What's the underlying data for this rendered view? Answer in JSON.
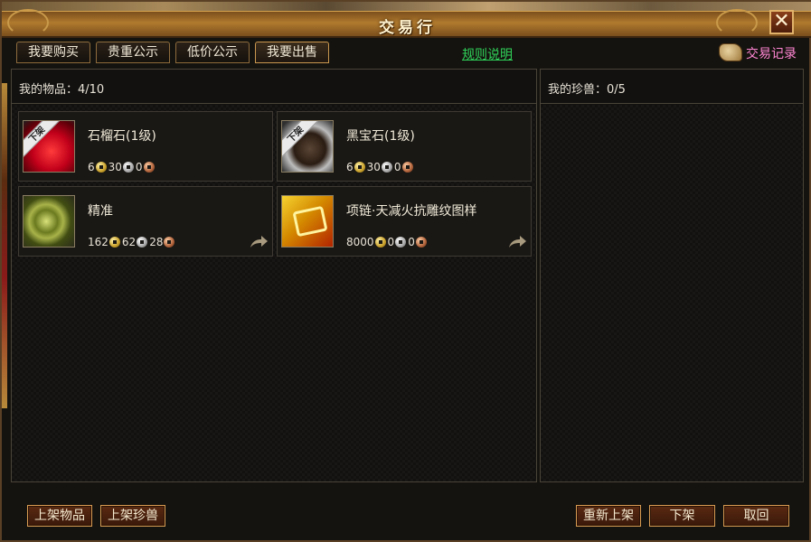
{
  "window": {
    "title": "交易行",
    "close_symbol": "✕"
  },
  "tabs": [
    {
      "label": "我要购买"
    },
    {
      "label": "贵重公示"
    },
    {
      "label": "低价公示"
    },
    {
      "label": "我要出售"
    }
  ],
  "rules_link": "规则说明",
  "trade_record": "交易记录",
  "items_panel": {
    "header": "我的物品：4/10",
    "items": [
      {
        "name": "石榴石(1级)",
        "ribbon": "下架",
        "icon": "garnet-gem-icon",
        "gold": "6",
        "silver": "30",
        "copper": "0",
        "shareable": false
      },
      {
        "name": "黑宝石(1级)",
        "ribbon": "下架",
        "icon": "black-gem-icon",
        "gold": "6",
        "silver": "30",
        "copper": "0",
        "shareable": false
      },
      {
        "name": "精准",
        "ribbon": "",
        "icon": "precision-skill-icon",
        "gold": "162",
        "silver": "62",
        "copper": "28",
        "shareable": true
      },
      {
        "name": "项链·天减火抗雕纹图样",
        "ribbon": "",
        "icon": "necklace-pattern-icon",
        "gold": "8000",
        "silver": "0",
        "copper": "0",
        "shareable": true
      }
    ]
  },
  "pets_panel": {
    "header": "我的珍兽：0/5"
  },
  "buttons": {
    "list_item": "上架物品",
    "list_pet": "上架珍兽",
    "relist": "重新上架",
    "delist": "下架",
    "cancel": "取回"
  },
  "colors": {
    "accent_gold": "#d69b52",
    "link_green": "#2fd35a",
    "record_pink": "#ff86d3"
  }
}
